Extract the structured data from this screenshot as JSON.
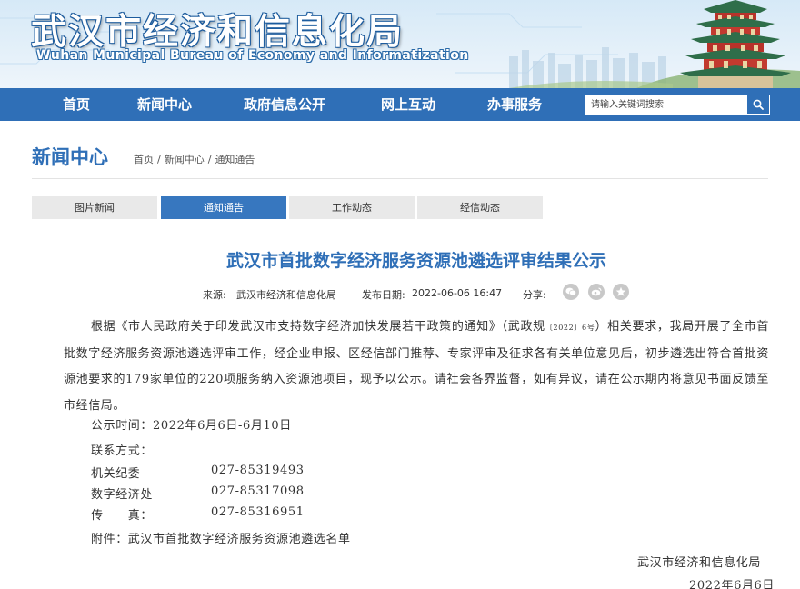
{
  "header": {
    "title": "武汉市经济和信息化局",
    "subtitle": "Wuhan Municipal Bureau of Economy and Informatization"
  },
  "nav": {
    "items": [
      "首页",
      "新闻中心",
      "政府信息公开",
      "网上互动",
      "办事服务"
    ],
    "search_placeholder": "请输入关键词搜索"
  },
  "page": {
    "section_title": "新闻中心",
    "breadcrumb": [
      "首页",
      "新闻中心",
      "通知通告"
    ],
    "tabs": [
      "图片新闻",
      "通知通告",
      "工作动态",
      "经信动态"
    ],
    "active_tab": "通知通告"
  },
  "article": {
    "title": "武汉市首批数字经济服务资源池遴选评审结果公示",
    "source_label": "来源:",
    "source": "武汉市经济和信息化局",
    "date_label": "发布日期:",
    "date": "2022-06-06 16:47",
    "share_label": "分享:",
    "body_part1": "根据《市人民政府关于印发武汉市支持数字经济加快发展若干政策的通知》（武政规",
    "body_doc_no": "〔2022〕6号",
    "body_part2": "）相关要求，我局开展了全市首批数字经济服务资源池遴选评审工作，经企业申报、区经信部门推荐、专家评审及征求各有关单位意见后，初步遴选出符合首批资源池要求的179家单位的220项服务纳入资源池项目，现予以公示。请社会各界监督，如有异议，请在公示期内将意见书面反馈至市经信局。",
    "period": "公示时间：2022年6月6日-6月10日",
    "contact_label": "联系方式：",
    "contacts": [
      {
        "name": "机关纪委",
        "phone": "027-85319493"
      },
      {
        "name": "数字经济处",
        "phone": "027-85317098"
      },
      {
        "name": "传　　真：",
        "phone": "027-85316951"
      }
    ],
    "attachment": "附件：武汉市首批数字经济服务资源池遴选名单",
    "signature_org": "武汉市经济和信息化局",
    "signature_date": "2022年6月6日"
  },
  "colors": {
    "brand_blue": "#2f6fb7",
    "tab_active": "#3777bf",
    "tab_inactive": "#e9e9e9"
  },
  "icons": [
    "search-icon",
    "wechat-icon",
    "weibo-icon",
    "favorite-icon",
    "tower-illustration"
  ]
}
